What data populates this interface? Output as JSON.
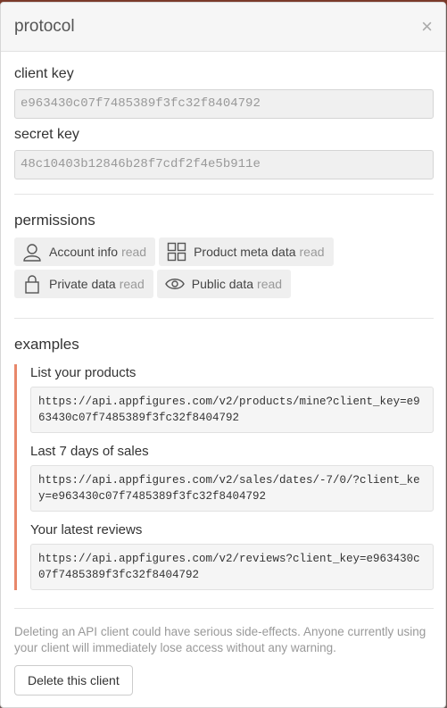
{
  "dialog": {
    "title": "protocol",
    "close_glyph": "×"
  },
  "credentials": {
    "client_key_label": "client key",
    "client_key_value": "e963430c07f7485389f3fc32f8404792",
    "secret_key_label": "secret key",
    "secret_key_value": "48c10403b12846b28f7cdf2f4e5b911e"
  },
  "permissions": {
    "title": "permissions",
    "items": [
      {
        "label": "Account info",
        "suffix": "read",
        "icon": "user-icon"
      },
      {
        "label": "Product meta data",
        "suffix": "read",
        "icon": "grid-icon"
      },
      {
        "label": "Private data",
        "suffix": "read",
        "icon": "lock-icon"
      },
      {
        "label": "Public data",
        "suffix": "read",
        "icon": "eye-icon"
      }
    ]
  },
  "examples": {
    "title": "examples",
    "items": [
      {
        "label": "List your products",
        "url": "https://api.appfigures.com/v2/products/mine?client_key=e963430c07f7485389f3fc32f8404792"
      },
      {
        "label": "Last 7 days of sales",
        "url": "https://api.appfigures.com/v2/sales/dates/-7/0/?client_key=e963430c07f7485389f3fc32f8404792"
      },
      {
        "label": "Your latest reviews",
        "url": "https://api.appfigures.com/v2/reviews?client_key=e963430c07f7485389f3fc32f8404792"
      }
    ]
  },
  "danger": {
    "warning": "Deleting an API client could have serious side-effects. Anyone currently using your client will immediately lose access without any warning.",
    "delete_label": "Delete this client"
  },
  "colors": {
    "accent_border": "#e8876a",
    "header_bg": "#f6f6f6",
    "chip_bg": "#efefef"
  }
}
